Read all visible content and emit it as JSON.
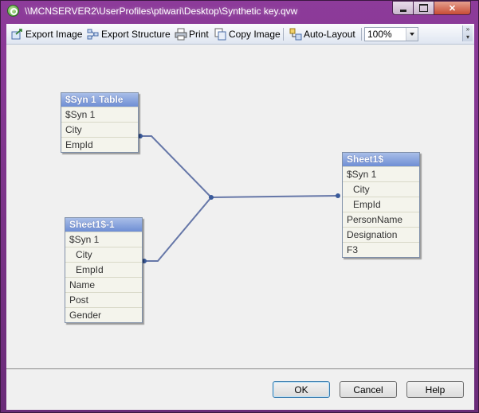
{
  "window": {
    "title": "\\\\MCNSERVER2\\UserProfiles\\ptiwari\\Desktop\\Synthetic key.qvw"
  },
  "toolbar": {
    "export_image": "Export Image",
    "export_structure": "Export Structure",
    "print": "Print",
    "copy_image": "Copy Image",
    "auto_layout": "Auto-Layout",
    "zoom": "100%"
  },
  "tables": [
    {
      "name": "$Syn 1 Table",
      "fields": [
        "$Syn 1",
        "City",
        "EmpId"
      ]
    },
    {
      "name": "Sheet1$-1",
      "fields": [
        "$Syn 1",
        "City",
        "EmpId",
        "Name",
        "Post",
        "Gender"
      ]
    },
    {
      "name": "Sheet1$",
      "fields": [
        "$Syn 1",
        "City",
        "EmpId",
        "PersonName",
        "Designation",
        "F3"
      ]
    }
  ],
  "buttons": {
    "ok": "OK",
    "cancel": "Cancel",
    "help": "Help"
  },
  "colors": {
    "title_bar": "#7b2f86",
    "table_header": "#6e8ed4",
    "link_line": "#6677a8"
  }
}
